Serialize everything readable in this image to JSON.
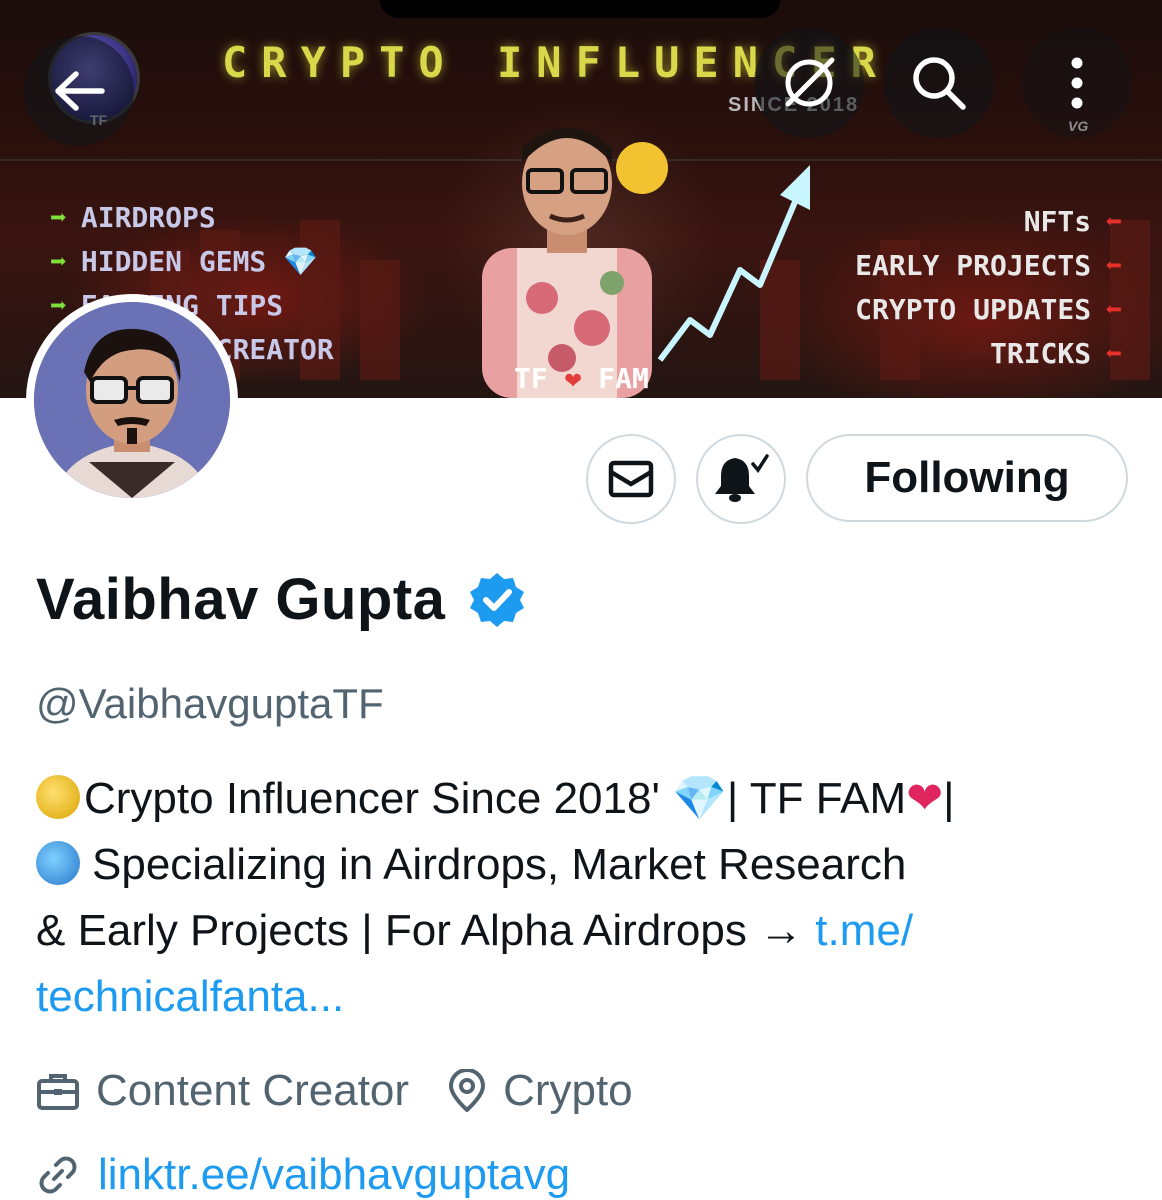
{
  "banner": {
    "title": "CRYPTO INFLUENCER",
    "since": "SINCE 2018",
    "logo_label": "TF",
    "avatar_label": "VG",
    "left_list": [
      "AIRDROPS",
      "HIDDEN GEMS 💎",
      "EARNING TIPS",
      "CONTENT CREATOR"
    ],
    "right_list": [
      "NFTs",
      "EARLY PROJECTS",
      "CRYPTO UPDATES",
      "TRICKS"
    ],
    "fam_left": "TF",
    "fam_right": "FAM"
  },
  "header": {
    "back_icon": "arrow-left-icon",
    "grok_icon": "grok-icon",
    "search_icon": "search-icon",
    "more_icon": "more-vertical-icon"
  },
  "actions": {
    "message_icon": "mail-icon",
    "notify_icon": "bell-check-icon",
    "follow_label": "Following"
  },
  "profile": {
    "name": "Vaibhav Gupta",
    "handle": "@VaibhavguptaTF",
    "bio_line1": "Crypto Influencer Since 2018'",
    "bio_line1_mid": "| TF FAM",
    "bio_line1_end": "|",
    "bio_line2": "Specializing in Airdrops, Market Research",
    "bio_line3": "& Early Projects | For Alpha Airdrops → ",
    "bio_link_part1": "t.me/",
    "bio_link_part2": "technicalfanta...",
    "profession": "Content Creator",
    "location": "Crypto",
    "website": "linktr.ee/vaibhavguptavg"
  },
  "colors": {
    "accent": "#1d9bf0",
    "text_primary": "#0f1419",
    "text_secondary": "#536471",
    "border": "#cfd9de"
  }
}
